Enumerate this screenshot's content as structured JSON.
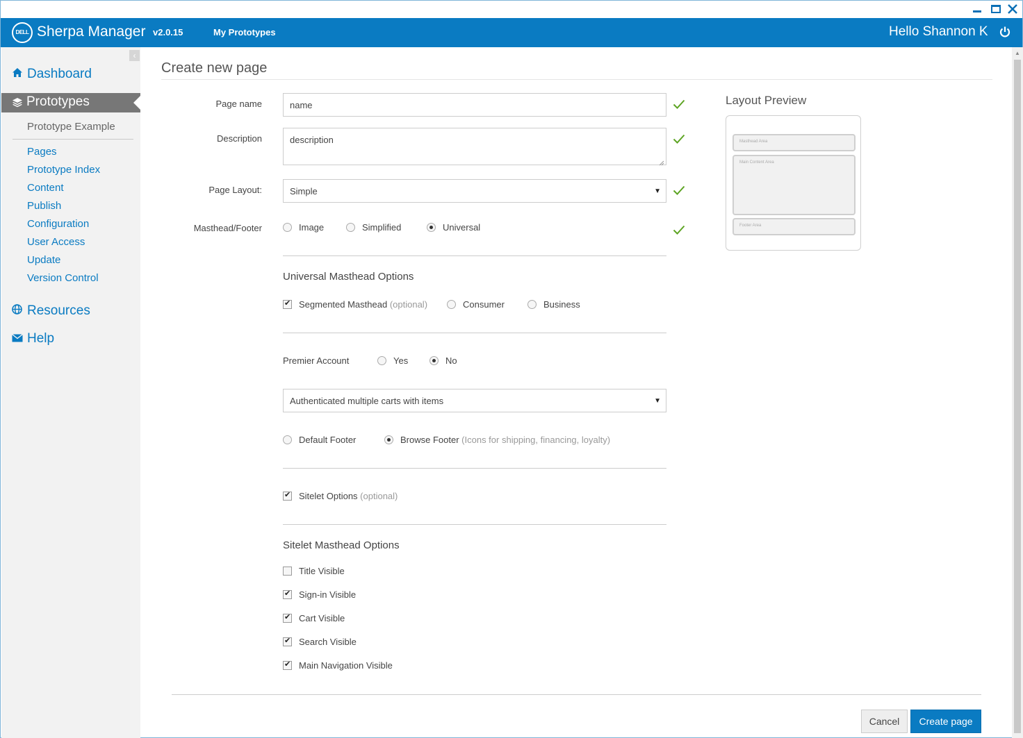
{
  "window": {
    "minimize_icon": "minimize-icon",
    "maximize_icon": "maximize-icon",
    "close_icon": "close-icon"
  },
  "header": {
    "logo_text": "DELL",
    "app_name": "Sherpa Manager",
    "version": "v2.0.15",
    "nav_link": "My Prototypes",
    "greeting": "Hello Shannon K",
    "brand_color": "#0a7bc2"
  },
  "sidebar": {
    "collapse_icon": "‹",
    "dashboard": "Dashboard",
    "prototypes": "Prototypes",
    "prototype_name": "Prototype Example",
    "items": [
      "Pages",
      "Prototype Index",
      "Content",
      "Publish",
      "Configuration",
      "User Access",
      "Update",
      "Version Control"
    ],
    "resources": "Resources",
    "help": "Help"
  },
  "form": {
    "title": "Create new page",
    "page_name_label": "Page name",
    "page_name_value": "name",
    "description_label": "Description",
    "description_value": "description",
    "layout_label": "Page Layout:",
    "layout_value": "Simple",
    "masthead_label": "Masthead/Footer",
    "masthead_options": [
      "Image",
      "Simplified",
      "Universal"
    ],
    "masthead_selected": "Universal",
    "universal_title": "Universal Masthead Options",
    "segmented_label": "Segmented Masthead",
    "optional": "(optional)",
    "consumer": "Consumer",
    "business": "Business",
    "premier_label": "Premier Account",
    "yes": "Yes",
    "no": "No",
    "cart_value": "Authenticated multiple carts with items",
    "default_footer": "Default Footer",
    "browse_footer": "Browse Footer",
    "browse_footer_hint": "(Icons for shipping, financing, loyalty)",
    "sitelet_label": "Sitelet Options",
    "sitelet_title": "Sitelet Masthead Options",
    "sitelet_checks": [
      {
        "label": "Title Visible",
        "checked": false
      },
      {
        "label": "Sign-in Visible",
        "checked": true
      },
      {
        "label": "Cart Visible",
        "checked": true
      },
      {
        "label": "Search Visible",
        "checked": true
      },
      {
        "label": "Main Navigation Visible",
        "checked": true
      }
    ]
  },
  "preview": {
    "title": "Layout Preview",
    "masthead": "Masthead Area",
    "main": "Main Content Area",
    "footer": "Footer Area"
  },
  "buttons": {
    "cancel": "Cancel",
    "create": "Create page"
  },
  "colors": {
    "valid_check": "#5da423",
    "accent": "#0a7bc2"
  }
}
